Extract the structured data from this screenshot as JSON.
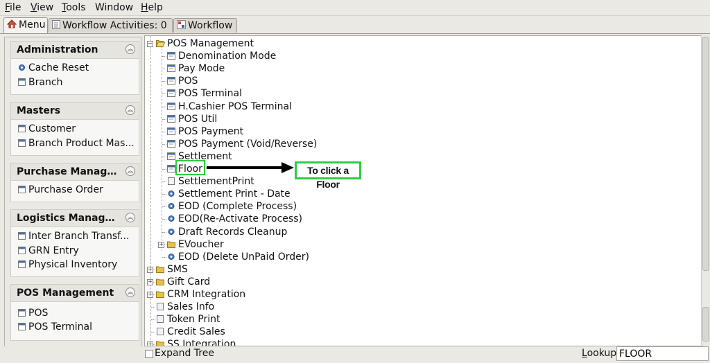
{
  "menubar": {
    "items": [
      {
        "label": "File",
        "mnemonic": "F"
      },
      {
        "label": "View",
        "mnemonic": "V"
      },
      {
        "label": "Tools",
        "mnemonic": "T"
      },
      {
        "label": "Window",
        "mnemonic": ""
      },
      {
        "label": "Help",
        "mnemonic": "H"
      }
    ]
  },
  "tabs": [
    {
      "label": "Menu",
      "icon": "home-icon",
      "active": true
    },
    {
      "label": "Workflow Activities: 0",
      "icon": "list-icon",
      "active": false
    },
    {
      "label": "Workflow",
      "icon": "workflow-icon",
      "active": false
    }
  ],
  "sidebar": {
    "groups": [
      {
        "title": "Administration",
        "items": [
          {
            "label": "Cache Reset",
            "icon": "gear-icon"
          },
          {
            "label": "Branch",
            "icon": "form-icon"
          }
        ]
      },
      {
        "title": "Masters",
        "items": [
          {
            "label": "Customer",
            "icon": "form-icon"
          },
          {
            "label": "Branch Product Mas...",
            "icon": "form-icon"
          }
        ]
      },
      {
        "title": "Purchase Manage...",
        "items": [
          {
            "label": "Purchase Order",
            "icon": "form-icon"
          }
        ]
      },
      {
        "title": "Logistics Manage...",
        "items": [
          {
            "label": "Inter Branch Transf...",
            "icon": "form-icon"
          },
          {
            "label": "GRN Entry",
            "icon": "form-icon"
          },
          {
            "label": "Physical Inventory",
            "icon": "form-icon"
          }
        ]
      },
      {
        "title": "POS Management",
        "items": [
          {
            "label": "POS",
            "icon": "form-icon"
          },
          {
            "label": "POS Terminal",
            "icon": "form-icon"
          }
        ]
      }
    ]
  },
  "tree": {
    "root": {
      "label": "POS Management",
      "icon": "folder-open-icon"
    },
    "children": [
      {
        "label": "Denomination Mode",
        "icon": "form-icon"
      },
      {
        "label": "Pay Mode",
        "icon": "form-icon"
      },
      {
        "label": "POS",
        "icon": "form-icon"
      },
      {
        "label": "POS Terminal",
        "icon": "form-icon"
      },
      {
        "label": "H.Cashier POS Terminal",
        "icon": "form-icon"
      },
      {
        "label": "POS Util",
        "icon": "form-icon"
      },
      {
        "label": "POS Payment",
        "icon": "form-icon"
      },
      {
        "label": "POS Payment (Void/Reverse)",
        "icon": "form-icon"
      },
      {
        "label": "Settlement",
        "icon": "form-icon"
      },
      {
        "label": "Floor",
        "icon": "form-icon",
        "highlighted": true
      },
      {
        "label": "SettlementPrint",
        "icon": "report-icon"
      },
      {
        "label": "Settlement Print - Date",
        "icon": "gear-icon"
      },
      {
        "label": "EOD (Complete Process)",
        "icon": "gear-icon"
      },
      {
        "label": "EOD(Re-Activate Process)",
        "icon": "gear-icon"
      },
      {
        "label": "Draft Records Cleanup",
        "icon": "gear-icon"
      },
      {
        "label": "EVoucher",
        "icon": "folder-icon",
        "expandable": true
      },
      {
        "label": "EOD (Delete UnPaid Order)",
        "icon": "gear-icon"
      }
    ],
    "siblings": [
      {
        "label": "SMS",
        "icon": "folder-icon",
        "expandable": true
      },
      {
        "label": "Gift Card",
        "icon": "folder-icon",
        "expandable": true
      },
      {
        "label": "CRM Integration",
        "icon": "folder-icon",
        "expandable": true
      },
      {
        "label": "Sales Info",
        "icon": "report-icon"
      },
      {
        "label": "Token Print",
        "icon": "report-icon"
      },
      {
        "label": "Credit Sales",
        "icon": "report-icon"
      },
      {
        "label": "SS Integration",
        "icon": "folder-icon",
        "expandable": true
      }
    ]
  },
  "annotation": {
    "text": "To click a Floor",
    "color": "#2ecc40"
  },
  "footer": {
    "expand_tree_label": "Expand Tree",
    "lookup_label": "Lookup",
    "lookup_mnemonic": "L",
    "lookup_value": "FLOOR"
  },
  "colors": {
    "folder": "#e8c04a",
    "form_icon": "#4a6fa5",
    "gear": "#4a7fc1",
    "highlight": "#2ecc40"
  }
}
